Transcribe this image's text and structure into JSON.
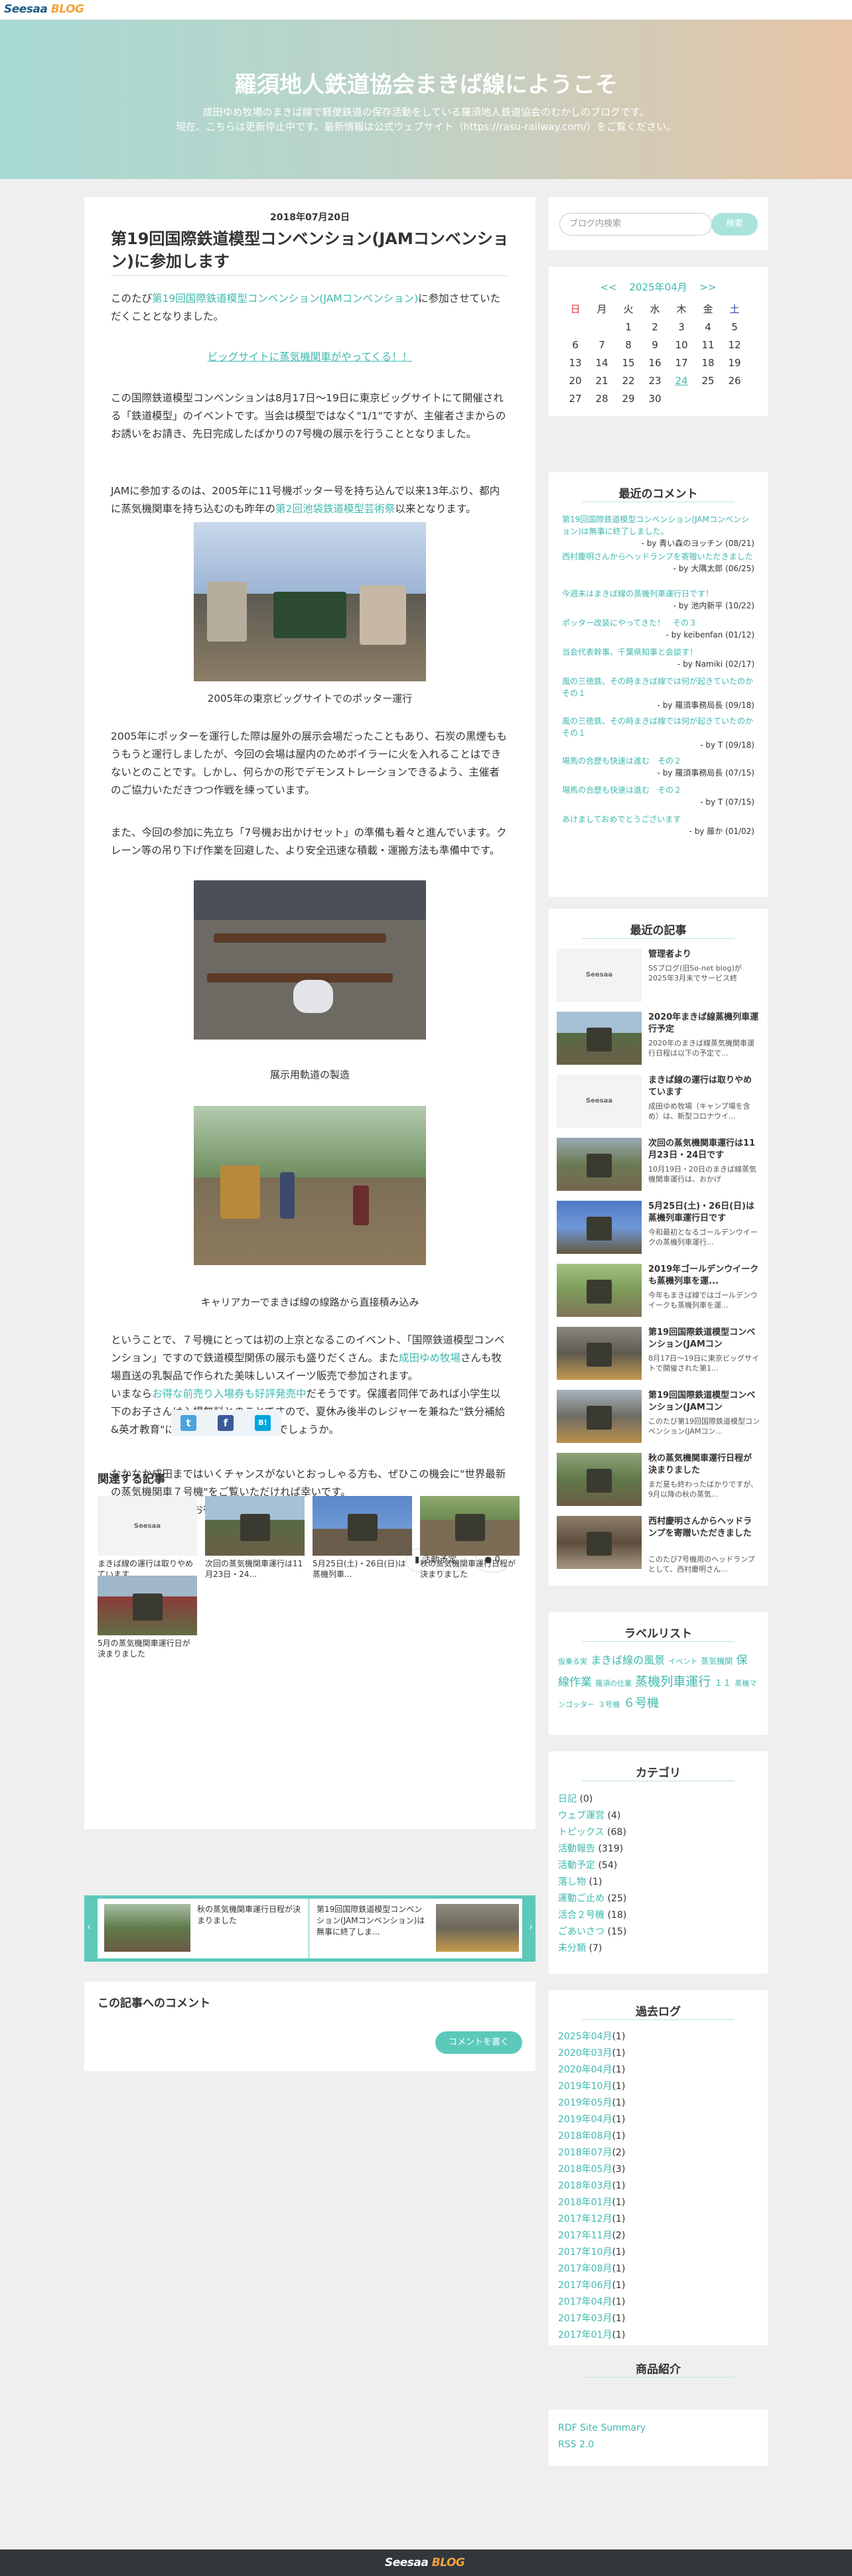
{
  "header": {
    "logo_main": "Seesaa",
    "logo_sub": "BLOG",
    "blog_title": "羅須地人鉄道協会まきば線にようこそ",
    "description_line1": "成田ゆめ牧場のまきば線で軽便鉄道の保存活動をしている羅須地人鉄道協会のむかしのブログです。",
    "description_line2": "現在、こちらは更新停止中です。最新情報は公式ウェブサイト（https://rasu-railway.com/）をご覧ください。"
  },
  "post": {
    "date": "2018年07月20日",
    "title": "第19回国際鉄道模型コンベンション(JAMコンベンション)に参加します",
    "p1_before": "このたび",
    "p1_link": "第19回国際鉄道模型コンベンション(JAMコンベンション)",
    "p1_after": "に参加させていただくこととなりました。",
    "center_link": "ビッグサイトに蒸気機関車がやってくる！！",
    "p2": "この国際鉄道模型コンベンションは8月17日〜19日に東京ビッグサイトにて開催される「鉄道模型」のイベントです。当会は模型ではなく\"1/1\"ですが、主催者さまからのお誘いをお請き、先日完成したばかりの7号機の展示を行うこととなりました。",
    "p3_before": "JAMに参加するのは、2005年に11号機ポッター号を持ち込んで以来13年ぶり、都内に蒸気機関車を持ち込むのも昨年の",
    "p3_link": "第2回池袋鉄道模型芸術祭",
    "p3_after": "以来となります。",
    "caption1": "2005年の東京ビッグサイトでのポッター運行",
    "p4": "2005年にポッターを運行した際は屋外の展示会場だったこともあり、石炭の黒煙ももうもうと運行しましたが、今回の会場は屋内のためボイラーに火を入れることはできないとのことです。しかし、何らかの形でデモンストレーションできるよう、主催者のご協力いただきつつ作戦を練っています。",
    "p5": "また、今回の参加に先立ち「7号機お出かけセット」の準備も着々と進んでいます。クレーン等の吊り下げ作業を回避した、より安全迅速な積載・運搬方法も準備中です。",
    "caption2": "展示用軌道の製造",
    "caption3": "キャリアカーでまきば線の線路から直接積み込み",
    "p6_1": "ということで、７号機にとっては初の上京となるこのイベント、「国際鉄道模型コンベンション」ですので鉄道模型関係の展示も盛りだくさん。また",
    "p6_link1": "成田ゆめ牧場",
    "p6_2": "さんも牧場直送の乳製品で作られた美味しいスイーツ販売で参加されます。",
    "p6_3": "いまなら",
    "p6_link2": "お得な前売り入場券も好評発売中",
    "p6_4": "だそうです。保護者同伴であれば小学生以下のお子さんは入場無料とのことですので、夏休み後半のレジャーを兼ねた\"鉄分補給&英才教育\"にもよろしいのではないでしょうか。",
    "p7": "なかなか成田まではいくチャンスがないとおっしゃる方も、ぜひこの機会に\"世界最新の蒸気機関車７号機\"をご覧いただければ幸いです。\n皆さんのおいでをお待ちしています！",
    "category_tag": "活動予定",
    "comment_count": "0",
    "share": {
      "twitter": "t",
      "facebook": "f",
      "hatena": "B!"
    },
    "related_heading": "関連する記事",
    "related": [
      {
        "title": "まきば線の運行は取りやめています"
      },
      {
        "title": "次回の蒸気機関車運行は11月23日・24..."
      },
      {
        "title": "5月25日(土)・26日(日)は蒸機列車..."
      },
      {
        "title": "秋の蒸気機関車運行日程が決まりました"
      },
      {
        "title": "5月の蒸気機関車運行日が決まりました"
      }
    ],
    "prev_title": "秋の蒸気機関車運行日程が決まりました",
    "next_title": "第19回国際鉄道模型コンベンション(JAMコンベンション)は無事に終了しま...",
    "comments_heading": "この記事へのコメント",
    "comment_button": "コメントを書く"
  },
  "sidebar": {
    "search_placeholder": "ブログ内検索",
    "search_button": "検索",
    "calendar": {
      "prev": "<<",
      "month": "2025年04月",
      "next": ">>",
      "weekdays": [
        "日",
        "月",
        "火",
        "水",
        "木",
        "金",
        "土"
      ],
      "weeks": [
        [
          "",
          "",
          "1",
          "2",
          "3",
          "4",
          "5"
        ],
        [
          "6",
          "7",
          "8",
          "9",
          "10",
          "11",
          "12"
        ],
        [
          "13",
          "14",
          "15",
          "16",
          "17",
          "18",
          "19"
        ],
        [
          "20",
          "21",
          "22",
          "23",
          "24",
          "25",
          "26"
        ],
        [
          "27",
          "28",
          "29",
          "30",
          "",
          "",
          ""
        ]
      ]
    },
    "recent_comments_title": "最近のコメント",
    "recent_comments": [
      {
        "link": "第19回国際鉄道模型コンベンション(JAMコンベンション)は無事に終了しました。",
        "by": "- by 青い森のヨッチン (08/21)"
      },
      {
        "link": "西村慶明さんからヘッドランプを寄贈いただきました",
        "by": "- by 大隅太郎 (06/25)"
      },
      {
        "link": "今週末はまきば線の蒸機列車運行日です！",
        "by": "- by 池内新平 (10/22)"
      },
      {
        "link": "ポッター改装にやってきた！　その３",
        "by": "- by keibenfan (01/12)"
      },
      {
        "link": "当会代表幹事、千葉県知事と会談す！",
        "by": "- by Namiki (02/17)"
      },
      {
        "link": "風の三徳鉄、その時まきば線では何が起きていたのか　その１",
        "by": "- by 羅須事務局長 (09/18)"
      },
      {
        "link": "風の三徳鉄、その時まきば線では何が起きていたのか　その１",
        "by": "- by T (09/18)"
      },
      {
        "link": "場馬の合歴も快速は進む　その２",
        "by": "- by 羅須事務局長 (07/15)"
      },
      {
        "link": "場馬の合歴も快速は進む　その２",
        "by": "- by T (07/15)"
      },
      {
        "link": "あけましておめでとうございます",
        "by": "- by 藤か (01/02)"
      }
    ],
    "recent_articles_title": "最近の記事",
    "recent_articles": [
      {
        "title": "管理者より",
        "desc": "SSブログ(旧So-net blog)が2025年3月末でサービス終",
        "seesaa": true
      },
      {
        "title": "2020年まきば線蒸機列車運行予定",
        "desc": "2020年のまきば線蒸気機関車運行日程は以下の予定で...",
        "seesaa": false
      },
      {
        "title": "まきば線の運行は取りやめています",
        "desc": "成田ゆめ牧場（キャンプ場を含め）は、新型コロナウイ...",
        "seesaa": true
      },
      {
        "title": "次回の蒸気機関車運行は11月23日・24日です",
        "desc": "10月19日・20日のまきば線蒸気機関車運行は、おかげ",
        "seesaa": false
      },
      {
        "title": "5月25日(土)・26日(日)は蒸機列車運行日です",
        "desc": "今和最初となるゴールデンウイークの蒸機列車運行...",
        "seesaa": false
      },
      {
        "title": "2019年ゴールデンウイークも蒸機列車を運...",
        "desc": "今年もまきば線ではゴールデンウイークも蒸機列車を運...",
        "seesaa": false
      },
      {
        "title": "第19回国際鉄道模型コンベンション(JAMコン",
        "desc": "8月17日〜19日に東京ビッグサイトで開催された第1...",
        "seesaa": false
      },
      {
        "title": "第19回国際鉄道模型コンベンション(JAMコン",
        "desc": "このたび第19回国際鉄道模型コンベンション(JAMコン...",
        "seesaa": false
      },
      {
        "title": "秋の蒸気機関車運行日程が決まりました",
        "desc": "まだ夏も終わったばかりですが、9月以降の秋の蒸気...",
        "seesaa": false
      },
      {
        "title": "西村慶明さんからヘッドランプを寄贈いただきました",
        "desc": "このたび7号機用のヘッドランプとして、西村慶明さん...",
        "seesaa": false
      }
    ],
    "label_list_title": "ラベルリスト",
    "labels": [
      {
        "text": "仮乗る実",
        "size": 11
      },
      {
        "text": "まきば線の風景",
        "size": 16
      },
      {
        "text": "イベント",
        "size": 11
      },
      {
        "text": "蒸気機関",
        "size": 12
      },
      {
        "text": "保線作業",
        "size": 17
      },
      {
        "text": "羅須の仕業",
        "size": 11
      },
      {
        "text": "蒸機列車運行",
        "size": 19
      },
      {
        "text": "１１",
        "size": 13
      },
      {
        "text": "蒸機マンゴッター",
        "size": 11
      },
      {
        "text": "３号機",
        "size": 11
      },
      {
        "text": "６号機",
        "size": 18
      }
    ],
    "categories_title": "カテゴリ",
    "categories": [
      {
        "name": "日記",
        "count": "(0)"
      },
      {
        "name": "ウェブ運営",
        "count": "(4)"
      },
      {
        "name": "トピックス",
        "count": "(68)"
      },
      {
        "name": "活動報告",
        "count": "(319)"
      },
      {
        "name": "活動予定",
        "count": "(54)"
      },
      {
        "name": "落し物",
        "count": "(1)"
      },
      {
        "name": "運動ご止め",
        "count": "(25)"
      },
      {
        "name": "活合２号機",
        "count": "(18)"
      },
      {
        "name": "ごあいさつ",
        "count": "(15)"
      },
      {
        "name": "未分類",
        "count": "(7)"
      }
    ],
    "archive_title": "過去ログ",
    "archive": [
      {
        "name": "2025年04月",
        "count": "(1)"
      },
      {
        "name": "2020年03月",
        "count": "(1)"
      },
      {
        "name": "2020年04月",
        "count": "(1)"
      },
      {
        "name": "2019年10月",
        "count": "(1)"
      },
      {
        "name": "2019年05月",
        "count": "(1)"
      },
      {
        "name": "2019年04月",
        "count": "(1)"
      },
      {
        "name": "2018年08月",
        "count": "(1)"
      },
      {
        "name": "2018年07月",
        "count": "(2)"
      },
      {
        "name": "2018年05月",
        "count": "(3)"
      },
      {
        "name": "2018年03月",
        "count": "(1)"
      },
      {
        "name": "2018年01月",
        "count": "(1)"
      },
      {
        "name": "2017年12月",
        "count": "(1)"
      },
      {
        "name": "2017年11月",
        "count": "(2)"
      },
      {
        "name": "2017年10月",
        "count": "(1)"
      },
      {
        "name": "2017年08月",
        "count": "(1)"
      },
      {
        "name": "2017年06月",
        "count": "(1)"
      },
      {
        "name": "2017年04月",
        "count": "(1)"
      },
      {
        "name": "2017年03月",
        "count": "(1)"
      },
      {
        "name": "2017年01月",
        "count": "(1)"
      }
    ],
    "products_title": "商品紹介",
    "feeds": [
      "RDF Site Summary",
      "RSS 2.0"
    ]
  },
  "footer": {
    "logo_main": "Seesaa",
    "logo_sub": "BLOG"
  },
  "colors": {
    "accent": "#3fb9ae",
    "nav_bar": "#5cc9bb",
    "footer": "#32373c",
    "sunday": "#e23c3c",
    "saturday": "#2d4ca5"
  }
}
